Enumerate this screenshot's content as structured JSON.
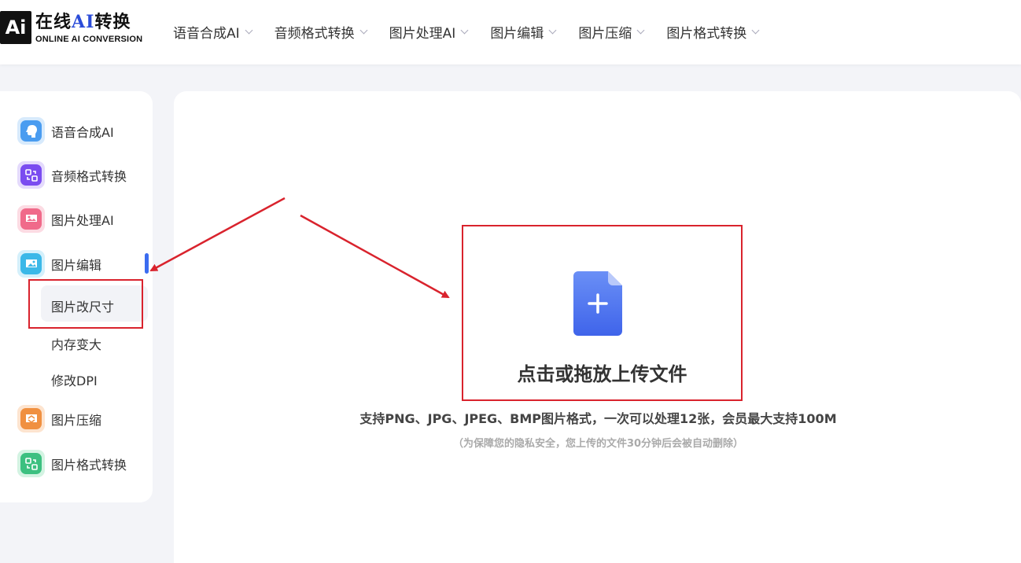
{
  "logo": {
    "badge": "Ai",
    "title_prefix": "在线",
    "title_ai": "AI",
    "title_suffix": "转换",
    "subtitle": "ONLINE AI CONVERSION"
  },
  "nav": [
    {
      "label": "语音合成AI"
    },
    {
      "label": "音频格式转换"
    },
    {
      "label": "图片处理AI"
    },
    {
      "label": "图片编辑"
    },
    {
      "label": "图片压缩"
    },
    {
      "label": "图片格式转换"
    }
  ],
  "sidebar": {
    "items": [
      {
        "label": "语音合成AI",
        "icon": "voice-icon",
        "color": "#4a9cf0"
      },
      {
        "label": "音频格式转换",
        "icon": "audio-convert-icon",
        "color": "#7a4cf0"
      },
      {
        "label": "图片处理AI",
        "icon": "image-ai-icon",
        "color": "#f06a8a"
      },
      {
        "label": "图片编辑",
        "icon": "image-edit-icon",
        "color": "#3bb8e8"
      },
      {
        "label": "图片压缩",
        "icon": "image-compress-icon",
        "color": "#f09040"
      },
      {
        "label": "图片格式转换",
        "icon": "image-convert-icon",
        "color": "#3cc080"
      }
    ],
    "subitems": [
      {
        "label": "图片改尺寸",
        "active": true
      },
      {
        "label": "内存变大"
      },
      {
        "label": "修改DPI"
      }
    ]
  },
  "upload": {
    "title": "点击或拖放上传文件",
    "support": "支持PNG、JPG、JPEG、BMP图片格式，一次可以处理12张，会员最大支持100M",
    "privacy": "（为保障您的隐私安全，您上传的文件30分钟后会被自动删除）"
  },
  "colors": {
    "accent": "#3b6cf0",
    "highlight": "#d9232d",
    "file_icon": "#4e78f2"
  }
}
